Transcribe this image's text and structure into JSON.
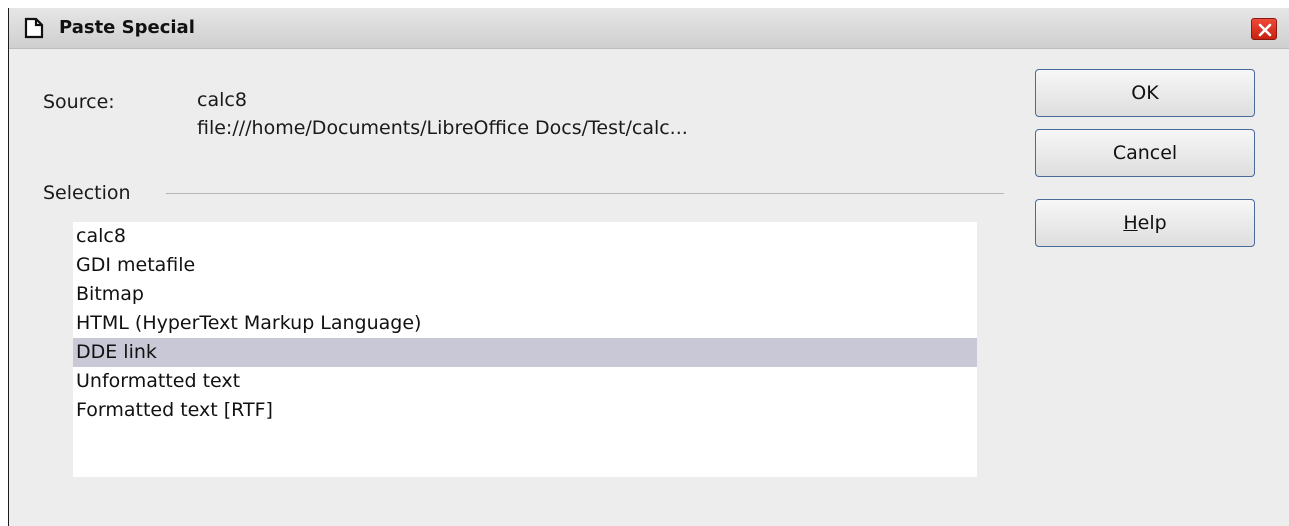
{
  "dialog": {
    "title": "Paste Special",
    "close_icon": "close-icon",
    "app_icon": "document-icon"
  },
  "source": {
    "label": "Source:",
    "name": "calc8",
    "path": "file:///home/Documents/LibreOffice Docs/Test/calc..."
  },
  "selection": {
    "label": "Selection",
    "items": [
      {
        "label": "calc8",
        "selected": false
      },
      {
        "label": "GDI metafile",
        "selected": false
      },
      {
        "label": "Bitmap",
        "selected": false
      },
      {
        "label": "HTML (HyperText Markup Language)",
        "selected": false
      },
      {
        "label": "DDE link",
        "selected": true
      },
      {
        "label": "Unformatted text",
        "selected": false
      },
      {
        "label": "Formatted text [RTF]",
        "selected": false
      }
    ]
  },
  "buttons": {
    "ok": "OK",
    "cancel": "Cancel",
    "help_mnemonic": "H",
    "help_rest": "elp"
  },
  "colors": {
    "selected_row": "#c8c8d6",
    "close_button": "#d9301c"
  }
}
